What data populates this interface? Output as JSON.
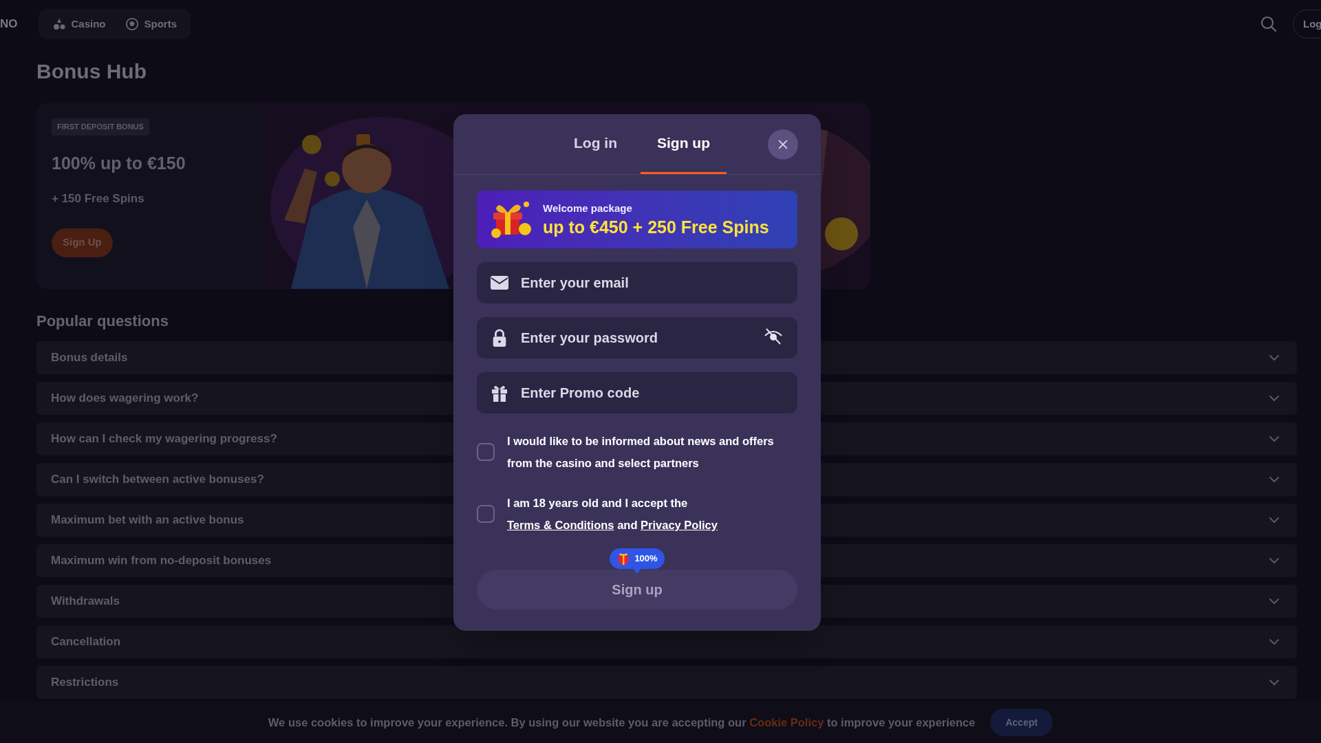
{
  "header": {
    "brand_fragment": "NO",
    "nav": [
      {
        "label": "Casino",
        "kind": "casino"
      },
      {
        "label": "Sports",
        "kind": "sports"
      }
    ],
    "login_button": "Log"
  },
  "page_title": "Bonus Hub",
  "promo_banner": {
    "badge": "FIRST DEPOSIT BONUS",
    "title": "100% up to €150",
    "subtitle": "+ 150 Free Spins",
    "button": "Sign Up"
  },
  "faq": {
    "title": "Popular questions",
    "items": [
      {
        "question": "Bonus details",
        "expanded": false
      },
      {
        "question": "How does wagering work?",
        "expanded": false
      },
      {
        "question": "How can I check my wagering progress?",
        "expanded": false
      },
      {
        "question": "Can I switch between active bonuses?",
        "expanded": false
      },
      {
        "question": "Maximum bet with an active bonus",
        "expanded": false
      },
      {
        "question": "Maximum win from no-deposit bonuses",
        "expanded": false
      },
      {
        "question": "Withdrawals",
        "expanded": false
      },
      {
        "question": "Cancellation",
        "expanded": false
      },
      {
        "question": "Restrictions",
        "expanded": false
      }
    ]
  },
  "modal": {
    "tabs": [
      {
        "label": "Log in",
        "selected": false
      },
      {
        "label": "Sign up",
        "selected": true
      }
    ],
    "welcome": {
      "label": "Welcome package",
      "offer": "up to €450 + 250 Free Spins"
    },
    "fields": [
      {
        "kind": "email",
        "placeholder": "Enter your email"
      },
      {
        "kind": "password",
        "placeholder": "Enter your password"
      },
      {
        "kind": "promo",
        "placeholder": "Enter Promo code"
      }
    ],
    "consents": [
      {
        "checked": false,
        "segments": [
          {
            "text": "I would like to be informed about news and offers from the casino and select partners"
          }
        ]
      },
      {
        "checked": false,
        "segments": [
          {
            "text": "I am 18 years old and I accept the "
          },
          {
            "text": "Terms & Conditions",
            "kind": "link"
          },
          {
            "text": " and "
          },
          {
            "text": "Privacy Policy",
            "kind": "link"
          }
        ]
      }
    ],
    "progress_badge": "100%",
    "submit_button": {
      "label": "Sign up",
      "disabled": true
    }
  },
  "cookie_banner": {
    "text_before": "We use cookies to improve your experience. By using our website you are accepting our ",
    "link": "Cookie Policy",
    "text_after": " to improve your experience",
    "button": "Accept"
  }
}
